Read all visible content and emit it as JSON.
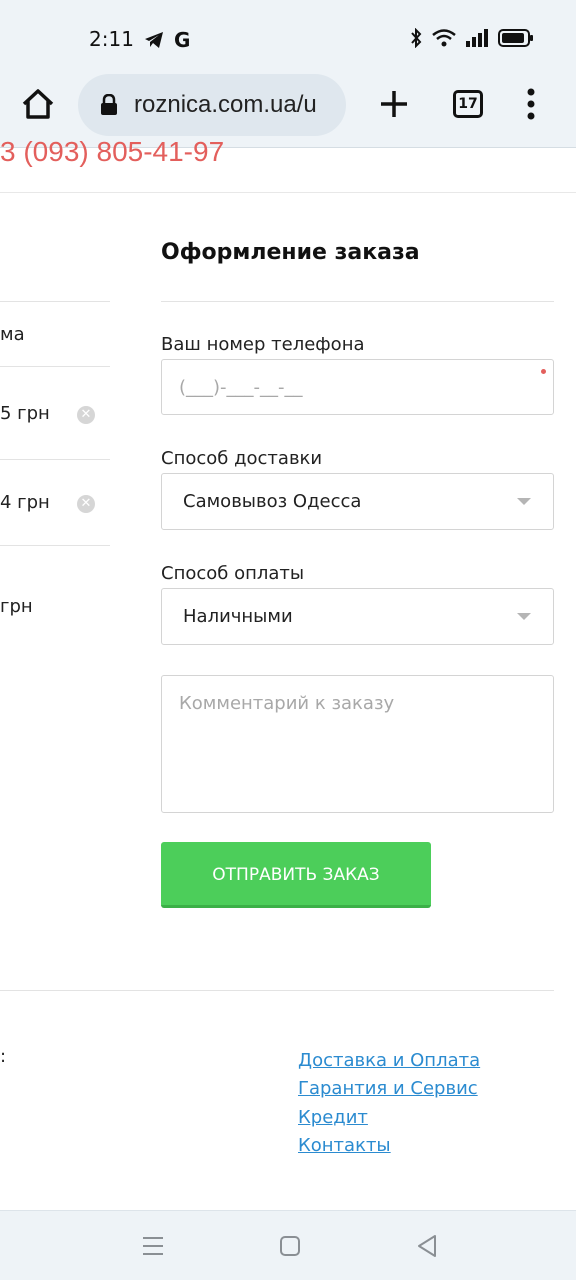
{
  "status_bar": {
    "time": "2:11",
    "g_letter": "G",
    "icons": [
      "telegram-icon",
      "google-icon",
      "bluetooth-icon",
      "wifi-icon",
      "signal-icon",
      "battery-icon"
    ]
  },
  "browser": {
    "url": "roznica.com.ua/u",
    "tab_count": "17"
  },
  "page": {
    "phone_partial": "3 (093) 805-41-97",
    "left_column": {
      "header_partial": "ма",
      "items": [
        {
          "price_partial": "5 грн"
        },
        {
          "price_partial": "4 грн"
        }
      ],
      "total_partial": "грн"
    },
    "form": {
      "title": "Оформление заказа",
      "phone_label": "Ваш номер телефона",
      "phone_placeholder": "(___)-___-__-__",
      "delivery_label": "Способ доставки",
      "delivery_value": "Самовывоз Одесса",
      "payment_label": "Способ оплаты",
      "payment_value": "Наличными",
      "comment_placeholder": "Комментарий к заказу",
      "submit_label": "ОТПРАВИТЬ ЗАКАЗ"
    },
    "footer": {
      "partial_colon": ":",
      "links": [
        "Доставка и Оплата",
        "Гарантия и Сервис",
        "Кредит",
        "Контакты"
      ]
    }
  },
  "colors": {
    "accent_red": "#e35f5c",
    "button_green": "#4cce5a",
    "link_blue": "#2b8bd0"
  }
}
